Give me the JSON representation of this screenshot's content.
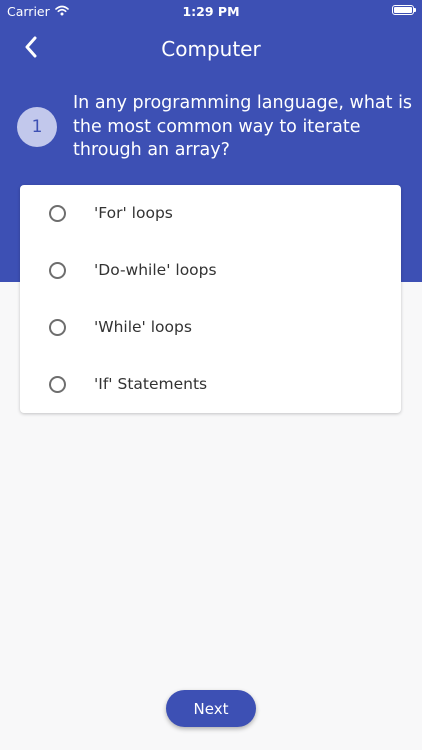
{
  "status_bar": {
    "carrier": "Carrier",
    "time": "1:29 PM",
    "wifi_icon": "wifi-icon",
    "battery_icon": "battery-icon",
    "battery_level": 1.0
  },
  "nav": {
    "title": "Computer",
    "back_icon": "chevron-left-icon"
  },
  "question": {
    "number": "1",
    "text": "In any programming language, what is the most common way to iterate through an array?"
  },
  "options": [
    {
      "label": "'For' loops",
      "selected": false
    },
    {
      "label": "'Do-while' loops",
      "selected": false
    },
    {
      "label": "'While' loops",
      "selected": false
    },
    {
      "label": "'If' Statements",
      "selected": false
    }
  ],
  "next_button": {
    "label": "Next"
  },
  "colors": {
    "primary": "#3d50b4",
    "number_badge": "#c2c8ec",
    "background": "#f8f8f9",
    "card": "#ffffff"
  }
}
